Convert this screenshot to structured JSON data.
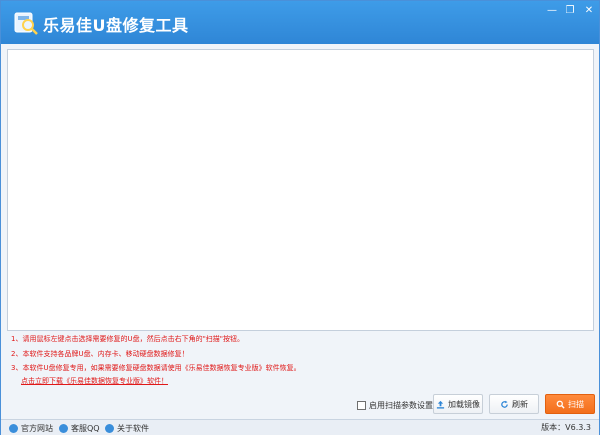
{
  "window": {
    "title": "乐易佳U盘修复工具",
    "minimize": "—",
    "restore": "❐",
    "close": "✕"
  },
  "tips": [
    "1、请用鼠标左键点击选择需要修复的U盘，然后点击右下角的\"扫描\"按钮。",
    "2、本软件支持各品牌U盘、内存卡、移动硬盘数据修复！",
    "3、本软件U盘修复专用，如果需要修复硬盘数据请使用《乐易佳数据恢复专业版》软件恢复。",
    "点击立即下载《乐易佳数据恢复专业版》软件！"
  ],
  "actions": {
    "scan_settings_label": "启用扫描参数设置",
    "scan_settings_checked": false,
    "load_image_label": "加载镜像",
    "refresh_label": "刷新",
    "scan_label": "扫描"
  },
  "footer": {
    "official_site": "官方网站",
    "support_qq": "客服QQ",
    "about": "关于软件",
    "version": "版本：V6.3.3"
  },
  "colors": {
    "titlebar": "#2f86d6",
    "tip_text": "#e01818",
    "scan_button": "#f36f1c"
  },
  "icons": {
    "app": "magnifier-drive-icon",
    "load_image": "upload-icon",
    "refresh": "refresh-icon",
    "scan": "search-icon",
    "official_site": "globe-icon",
    "support_qq": "qq-icon",
    "about": "info-icon"
  }
}
